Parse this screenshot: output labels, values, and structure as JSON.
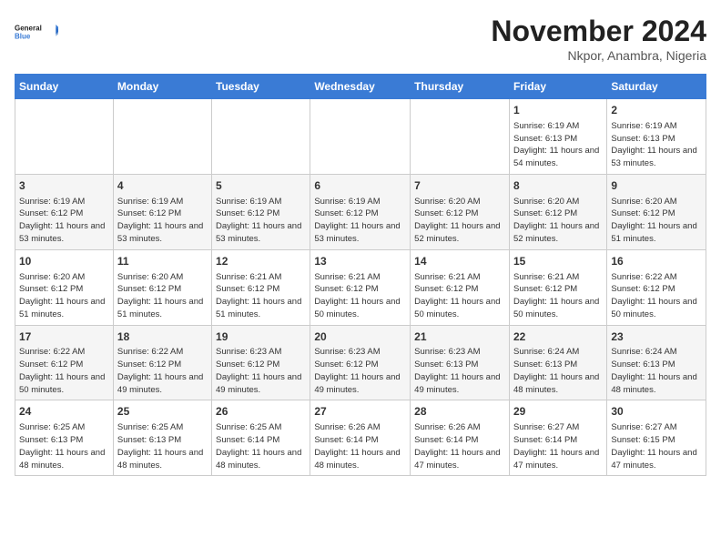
{
  "logo": {
    "line1": "General",
    "line2": "Blue"
  },
  "title": "November 2024",
  "location": "Nkpor, Anambra, Nigeria",
  "header_days": [
    "Sunday",
    "Monday",
    "Tuesday",
    "Wednesday",
    "Thursday",
    "Friday",
    "Saturday"
  ],
  "weeks": [
    [
      {
        "day": "",
        "info": ""
      },
      {
        "day": "",
        "info": ""
      },
      {
        "day": "",
        "info": ""
      },
      {
        "day": "",
        "info": ""
      },
      {
        "day": "",
        "info": ""
      },
      {
        "day": "1",
        "info": "Sunrise: 6:19 AM\nSunset: 6:13 PM\nDaylight: 11 hours and 54 minutes."
      },
      {
        "day": "2",
        "info": "Sunrise: 6:19 AM\nSunset: 6:13 PM\nDaylight: 11 hours and 53 minutes."
      }
    ],
    [
      {
        "day": "3",
        "info": "Sunrise: 6:19 AM\nSunset: 6:12 PM\nDaylight: 11 hours and 53 minutes."
      },
      {
        "day": "4",
        "info": "Sunrise: 6:19 AM\nSunset: 6:12 PM\nDaylight: 11 hours and 53 minutes."
      },
      {
        "day": "5",
        "info": "Sunrise: 6:19 AM\nSunset: 6:12 PM\nDaylight: 11 hours and 53 minutes."
      },
      {
        "day": "6",
        "info": "Sunrise: 6:19 AM\nSunset: 6:12 PM\nDaylight: 11 hours and 53 minutes."
      },
      {
        "day": "7",
        "info": "Sunrise: 6:20 AM\nSunset: 6:12 PM\nDaylight: 11 hours and 52 minutes."
      },
      {
        "day": "8",
        "info": "Sunrise: 6:20 AM\nSunset: 6:12 PM\nDaylight: 11 hours and 52 minutes."
      },
      {
        "day": "9",
        "info": "Sunrise: 6:20 AM\nSunset: 6:12 PM\nDaylight: 11 hours and 51 minutes."
      }
    ],
    [
      {
        "day": "10",
        "info": "Sunrise: 6:20 AM\nSunset: 6:12 PM\nDaylight: 11 hours and 51 minutes."
      },
      {
        "day": "11",
        "info": "Sunrise: 6:20 AM\nSunset: 6:12 PM\nDaylight: 11 hours and 51 minutes."
      },
      {
        "day": "12",
        "info": "Sunrise: 6:21 AM\nSunset: 6:12 PM\nDaylight: 11 hours and 51 minutes."
      },
      {
        "day": "13",
        "info": "Sunrise: 6:21 AM\nSunset: 6:12 PM\nDaylight: 11 hours and 50 minutes."
      },
      {
        "day": "14",
        "info": "Sunrise: 6:21 AM\nSunset: 6:12 PM\nDaylight: 11 hours and 50 minutes."
      },
      {
        "day": "15",
        "info": "Sunrise: 6:21 AM\nSunset: 6:12 PM\nDaylight: 11 hours and 50 minutes."
      },
      {
        "day": "16",
        "info": "Sunrise: 6:22 AM\nSunset: 6:12 PM\nDaylight: 11 hours and 50 minutes."
      }
    ],
    [
      {
        "day": "17",
        "info": "Sunrise: 6:22 AM\nSunset: 6:12 PM\nDaylight: 11 hours and 50 minutes."
      },
      {
        "day": "18",
        "info": "Sunrise: 6:22 AM\nSunset: 6:12 PM\nDaylight: 11 hours and 49 minutes."
      },
      {
        "day": "19",
        "info": "Sunrise: 6:23 AM\nSunset: 6:12 PM\nDaylight: 11 hours and 49 minutes."
      },
      {
        "day": "20",
        "info": "Sunrise: 6:23 AM\nSunset: 6:12 PM\nDaylight: 11 hours and 49 minutes."
      },
      {
        "day": "21",
        "info": "Sunrise: 6:23 AM\nSunset: 6:13 PM\nDaylight: 11 hours and 49 minutes."
      },
      {
        "day": "22",
        "info": "Sunrise: 6:24 AM\nSunset: 6:13 PM\nDaylight: 11 hours and 48 minutes."
      },
      {
        "day": "23",
        "info": "Sunrise: 6:24 AM\nSunset: 6:13 PM\nDaylight: 11 hours and 48 minutes."
      }
    ],
    [
      {
        "day": "24",
        "info": "Sunrise: 6:25 AM\nSunset: 6:13 PM\nDaylight: 11 hours and 48 minutes."
      },
      {
        "day": "25",
        "info": "Sunrise: 6:25 AM\nSunset: 6:13 PM\nDaylight: 11 hours and 48 minutes."
      },
      {
        "day": "26",
        "info": "Sunrise: 6:25 AM\nSunset: 6:14 PM\nDaylight: 11 hours and 48 minutes."
      },
      {
        "day": "27",
        "info": "Sunrise: 6:26 AM\nSunset: 6:14 PM\nDaylight: 11 hours and 48 minutes."
      },
      {
        "day": "28",
        "info": "Sunrise: 6:26 AM\nSunset: 6:14 PM\nDaylight: 11 hours and 47 minutes."
      },
      {
        "day": "29",
        "info": "Sunrise: 6:27 AM\nSunset: 6:14 PM\nDaylight: 11 hours and 47 minutes."
      },
      {
        "day": "30",
        "info": "Sunrise: 6:27 AM\nSunset: 6:15 PM\nDaylight: 11 hours and 47 minutes."
      }
    ]
  ]
}
